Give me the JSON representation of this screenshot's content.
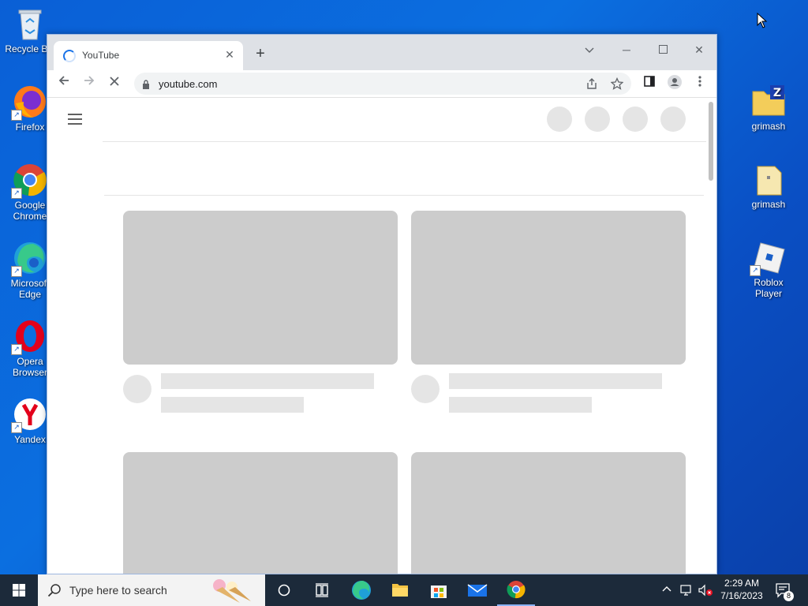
{
  "desktop": {
    "left_icons": [
      {
        "label": "Recycle Bin"
      },
      {
        "label": "Firefox"
      },
      {
        "label": "Google Chrome"
      },
      {
        "label": "Microsoft Edge"
      },
      {
        "label": "Opera Browser"
      },
      {
        "label": "Yandex"
      }
    ],
    "right_icons": [
      {
        "label": "grimash"
      },
      {
        "label": "grimash"
      },
      {
        "label": "Roblox Player"
      }
    ]
  },
  "browser": {
    "tab_title": "YouTube",
    "url": "youtube.com",
    "state": "loading"
  },
  "taskbar": {
    "search_placeholder": "Type here to search",
    "time": "2:29 AM",
    "date": "7/16/2023",
    "notification_count": "8"
  },
  "colors": {
    "desktop": "#0a5fd6",
    "skeleton_dark": "#cccccc",
    "skeleton_light": "#e5e5e5",
    "taskbar": "#1c2a3a"
  }
}
